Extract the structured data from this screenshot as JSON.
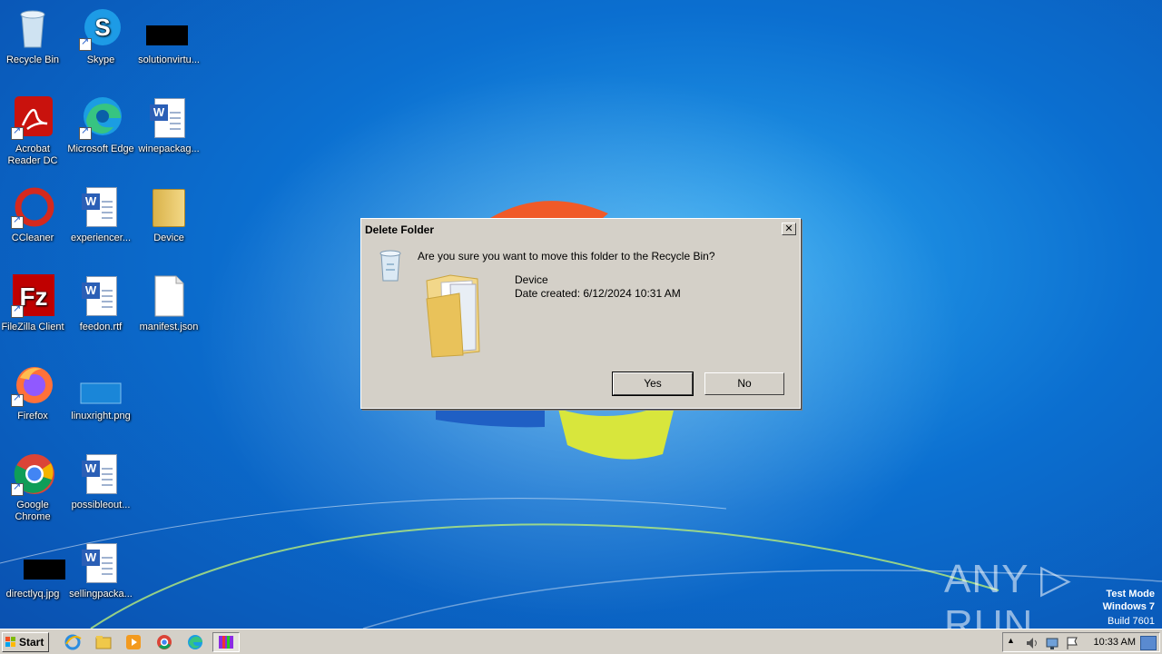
{
  "desktop": {
    "icons": [
      {
        "label": "Recycle Bin"
      },
      {
        "label": "Skype"
      },
      {
        "label": "solutionvirtu..."
      },
      {
        "label": "Acrobat Reader DC"
      },
      {
        "label": "Microsoft Edge"
      },
      {
        "label": "winepackag..."
      },
      {
        "label": "CCleaner"
      },
      {
        "label": "experiencer..."
      },
      {
        "label": "Device"
      },
      {
        "label": "FileZilla Client"
      },
      {
        "label": "feedon.rtf"
      },
      {
        "label": "manifest.json"
      },
      {
        "label": "Firefox"
      },
      {
        "label": "linuxright.png"
      },
      {
        "label": "Google Chrome"
      },
      {
        "label": "possibleout..."
      },
      {
        "label": "directlyq.jpg"
      },
      {
        "label": "sellingpacka..."
      }
    ]
  },
  "dialog": {
    "title": "Delete Folder",
    "close_label": "✕",
    "message": "Are you sure you want to move this folder to the Recycle Bin?",
    "item_name": "Device",
    "item_date": "Date created: 6/12/2024 10:31 AM",
    "yes_label": "Yes",
    "no_label": "No"
  },
  "taskbar": {
    "start_label": "Start",
    "clock": "10:33 AM",
    "tray_up": "▲"
  },
  "watermark": {
    "line1": "Test Mode",
    "line2": "Windows 7",
    "line3": "Build 7601",
    "brand": "ANY ▷ RUN"
  }
}
